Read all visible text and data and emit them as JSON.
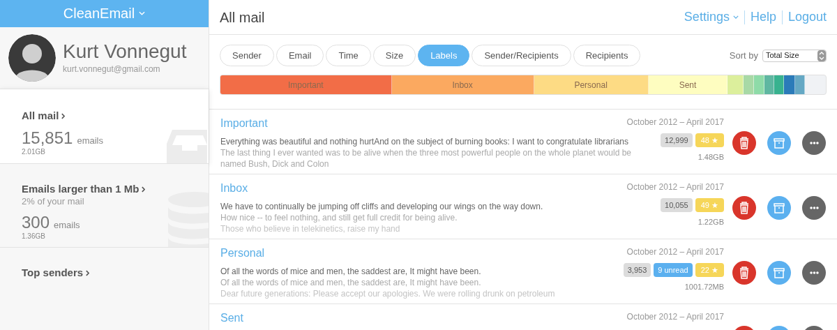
{
  "brand": {
    "title": "CleanEmail"
  },
  "user": {
    "name": "Kurt Vonnegut",
    "email": "kurt.vonnegut@gmail.com"
  },
  "sidebar": {
    "items": [
      {
        "title": "All mail",
        "kind": "inbox",
        "selected": true,
        "count": "15,851",
        "unit": "emails",
        "size": "2.01GB"
      },
      {
        "title": "Emails larger than 1 Mb",
        "subtitle": "2% of your mail",
        "kind": "database",
        "selected": false,
        "count": "300",
        "unit": "emails",
        "size": "1.36GB"
      },
      {
        "title": "Top senders",
        "kind": "none",
        "selected": false
      }
    ]
  },
  "page": {
    "title": "All mail"
  },
  "header_links": [
    {
      "label": "Settings",
      "dropdown": true
    },
    {
      "label": "Help",
      "dropdown": false
    },
    {
      "label": "Logout",
      "dropdown": false
    }
  ],
  "tabs": [
    {
      "label": "Sender",
      "selected": false
    },
    {
      "label": "Email",
      "selected": false
    },
    {
      "label": "Time",
      "selected": false
    },
    {
      "label": "Size",
      "selected": false
    },
    {
      "label": "Labels",
      "selected": true
    },
    {
      "label": "Sender/Recipients",
      "selected": false
    },
    {
      "label": "Recipients",
      "selected": false
    }
  ],
  "sort": {
    "label": "Sort by",
    "value": "Total Size"
  },
  "size_bar": [
    {
      "label": "Important",
      "color": "#f26d47"
    },
    {
      "label": "Inbox",
      "color": "#fba960"
    },
    {
      "label": "Personal",
      "color": "#fddb84"
    },
    {
      "label": "Sent",
      "color": "#fefdc0"
    },
    {
      "color": "#dcef9c"
    },
    {
      "color": "#a8d9a6"
    },
    {
      "color": "#8edba8"
    },
    {
      "color": "#5fb7a1"
    },
    {
      "color": "#38b28f"
    },
    {
      "color": "#2b7bb9"
    },
    {
      "color": "#65a8c4"
    }
  ],
  "labels": [
    {
      "name": "Important",
      "dates": "October 2012 – April 2017",
      "lines": [
        "Everything was beautiful and nothing hurtAnd on the subject of burning books: I want to congratulate librarians",
        "The last thing I ever wanted was to be alive when the three most powerful people on the whole planet would be named Bush, Dick and Colon"
      ],
      "count": "12,999",
      "starred": "48 ★",
      "size": "1.48GB"
    },
    {
      "name": "Inbox",
      "dates": "October 2012 – April 2017",
      "lines": [
        "We have to continually be jumping off cliffs and developing our wings on the way down.",
        "How nice -- to feel nothing, and still get full credit for being alive.",
        "Those who believe in telekinetics, raise my hand"
      ],
      "count": "10,055",
      "starred": "49 ★",
      "size": "1.22GB"
    },
    {
      "name": "Personal",
      "dates": "October 2012 – April 2017",
      "lines": [
        "Of all the words of mice and men, the saddest are, It might have been.",
        "Of all the words of mice and men, the saddest are, It might have been.",
        "Dear future generations: Please accept our apologies. We were rolling drunk on petroleum"
      ],
      "count": "3,953",
      "unread": "9 unread",
      "starred": "22 ★",
      "size": "1001.72MB"
    },
    {
      "name": "Sent",
      "dates": "October 2012 – April 2017"
    }
  ]
}
